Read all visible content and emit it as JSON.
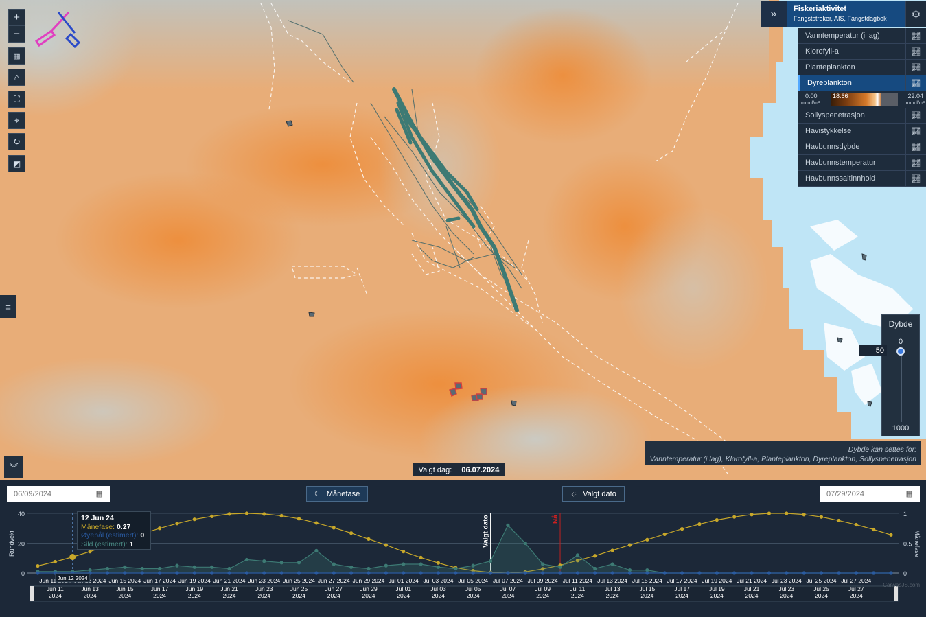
{
  "layer_panel": {
    "title": "Fiskeriaktivitet",
    "subtitle": "Fangststreker, AIS, Fangstdagbok",
    "items": [
      {
        "label": "Vanntemperatur (i lag)",
        "active": false
      },
      {
        "label": "Klorofyll-a",
        "active": false
      },
      {
        "label": "Planteplankton",
        "active": false
      },
      {
        "label": "Dyreplankton",
        "active": true
      },
      {
        "label": "Sollyspenetrasjon",
        "active": false
      },
      {
        "label": "Havistykkelse",
        "active": false
      },
      {
        "label": "Havbunnsdybde",
        "active": false
      },
      {
        "label": "Havbunnstemperatur",
        "active": false
      },
      {
        "label": "Havbunnssaltinnhold",
        "active": false
      }
    ],
    "legend": {
      "min": "0.00",
      "value": "18.66",
      "max": "22.04",
      "unit_left": "mmol/m³",
      "unit_right": "mmol/m³"
    }
  },
  "depth": {
    "title": "Dybde",
    "value": "50",
    "min_label": "0",
    "max_label": "1000",
    "level_fraction": 0.05
  },
  "depth_info": {
    "line1": "Dybde kan settes for:",
    "line2": "Vanntemperatur (i lag), Klorofyll-a, Planteplankton, Dyreplankton, Sollyspenetrasjon"
  },
  "selected_day": {
    "label": "Valgt dag:",
    "value": "06.07.2024"
  },
  "controls": {
    "start_date": "06/09/2024",
    "end_date": "07/29/2024",
    "moon_button": "Månefase",
    "date_button": "Valgt dato"
  },
  "chart": {
    "ylabel_left": "Rundvekt",
    "ylabel_right": "Månefase",
    "left_ticks": [
      "40",
      "20",
      "0"
    ],
    "right_ticks": [
      "1",
      "0.5",
      "0"
    ],
    "marker_selected": "Valgt dato",
    "marker_now": "Nå",
    "watermark": "CanvasJS.com",
    "tooltip": {
      "date": "12 Jun 24",
      "moon_label": "Månefase:",
      "moon_value": "0.27",
      "eel_label": "Øyepål (estimert):",
      "eel_value": "0",
      "herring_label": "Sild (estimert):",
      "herring_value": "1"
    },
    "hover_label": "Jun 12 2024",
    "x_labels": [
      "Jun 11 2024",
      "Jun 13 2024",
      "Jun 15 2024",
      "Jun 17 2024",
      "Jun 19 2024",
      "Jun 21 2024",
      "Jun 23 2024",
      "Jun 25 2024",
      "Jun 27 2024",
      "Jun 29 2024",
      "Jul 01 2024",
      "Jul 03 2024",
      "Jul 05 2024",
      "Jul 07 2024",
      "Jul 09 2024",
      "Jul 11 2024",
      "Jul 13 2024",
      "Jul 15 2024",
      "Jul 17 2024",
      "Jul 19 2024",
      "Jul 21 2024",
      "Jul 23 2024",
      "Jul 25 2024",
      "Jul 27 2024"
    ],
    "nav_labels": [
      "Jun 11 2024",
      "Jun 13 2024",
      "Jun 15 2024",
      "Jun 17 2024",
      "Jun 19 2024",
      "Jun 21 2024",
      "Jun 23 2024",
      "Jun 25 2024",
      "Jun 27 2024",
      "Jun 29 2024",
      "Jul 01 2024",
      "Jul 03 2024",
      "Jul 05 2024",
      "Jul 07 2024",
      "Jul 09 2024",
      "Jul 11 2024",
      "Jul 13 2024",
      "Jul 15 2024",
      "Jul 17 2024",
      "Jul 19 2024",
      "Jul 21 2024",
      "Jul 23 2024",
      "Jul 25 2024",
      "Jul 27 2024"
    ]
  },
  "chart_data": {
    "type": "line",
    "x_start": "2024-06-10",
    "series": [
      {
        "name": "Månefase",
        "axis": "right",
        "color": "#c8a82a",
        "values": [
          0.12,
          0.19,
          0.27,
          0.36,
          0.46,
          0.56,
          0.66,
          0.75,
          0.83,
          0.9,
          0.95,
          0.99,
          1.0,
          0.99,
          0.96,
          0.91,
          0.84,
          0.76,
          0.67,
          0.57,
          0.47,
          0.36,
          0.26,
          0.17,
          0.09,
          0.04,
          0.01,
          0.0,
          0.02,
          0.07,
          0.13,
          0.21,
          0.29,
          0.38,
          0.47,
          0.56,
          0.65,
          0.74,
          0.82,
          0.89,
          0.94,
          0.98,
          1.0,
          1.0,
          0.98,
          0.94,
          0.88,
          0.81,
          0.73,
          0.64
        ]
      },
      {
        "name": "Sild (estimert)",
        "axis": "left",
        "color": "#3d7a74",
        "values": [
          1,
          1,
          1,
          2,
          3,
          4,
          3,
          3,
          5,
          4,
          4,
          3,
          9,
          8,
          7,
          7,
          15,
          6,
          4,
          3,
          5,
          6,
          6,
          4,
          3,
          5,
          8,
          32,
          20,
          6,
          4,
          12,
          3,
          6,
          2,
          2,
          0,
          0,
          0,
          0,
          0,
          0,
          0,
          0,
          0,
          0,
          0,
          0,
          0,
          0
        ]
      },
      {
        "name": "Øyepål (estimert)",
        "axis": "left",
        "color": "#2a5aa0",
        "values": [
          0,
          0,
          0,
          0,
          0,
          0,
          0,
          0,
          0,
          0,
          0,
          0,
          0,
          0,
          0,
          0,
          0,
          0,
          0,
          0,
          0,
          0,
          0,
          0,
          0,
          0,
          0,
          0,
          0,
          0,
          0,
          0,
          0,
          0,
          0,
          0,
          0,
          0,
          0,
          0,
          0,
          0,
          0,
          0,
          0,
          0,
          0,
          0,
          0,
          0
        ]
      }
    ],
    "ylim_left": [
      0,
      40
    ],
    "ylim_right": [
      0,
      1
    ],
    "selected_date": "2024-07-06",
    "now_date": "2024-07-10"
  }
}
